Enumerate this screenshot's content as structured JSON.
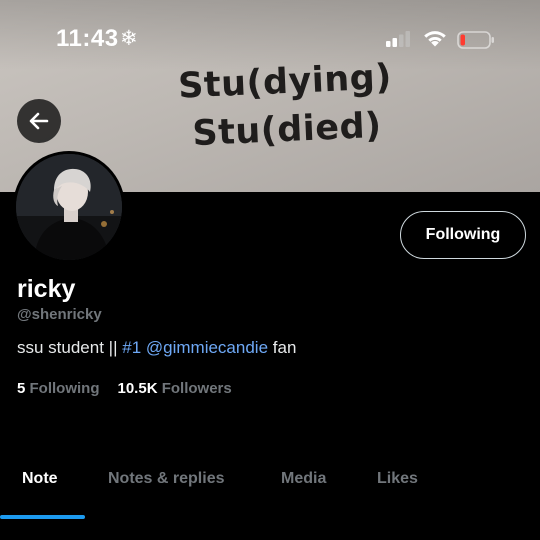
{
  "status_bar": {
    "time": "11:43",
    "focus_icon": "snowflake-icon"
  },
  "banner": {
    "line1": "Stu(dying)",
    "line2": "Stu(died)"
  },
  "profile": {
    "display_name": "ricky",
    "handle": "@shenricky",
    "bio_prefix": "ssu student || ",
    "bio_hashtag": "#1",
    "bio_mention": "@gimmiecandie",
    "bio_suffix": "fan",
    "following_count": "5",
    "following_label": "Following",
    "followers_count": "10.5K",
    "followers_label": "Followers"
  },
  "actions": {
    "follow_state_label": "Following"
  },
  "tabs": [
    {
      "label": "Note",
      "active": true
    },
    {
      "label": "Notes & replies",
      "active": false
    },
    {
      "label": "Media",
      "active": false
    },
    {
      "label": "Likes",
      "active": false
    }
  ],
  "colors": {
    "background": "#000000",
    "link": "#6ea8f5",
    "muted": "#71767b",
    "accent": "#1d9bf0",
    "battery_low": "#ff3b30"
  }
}
